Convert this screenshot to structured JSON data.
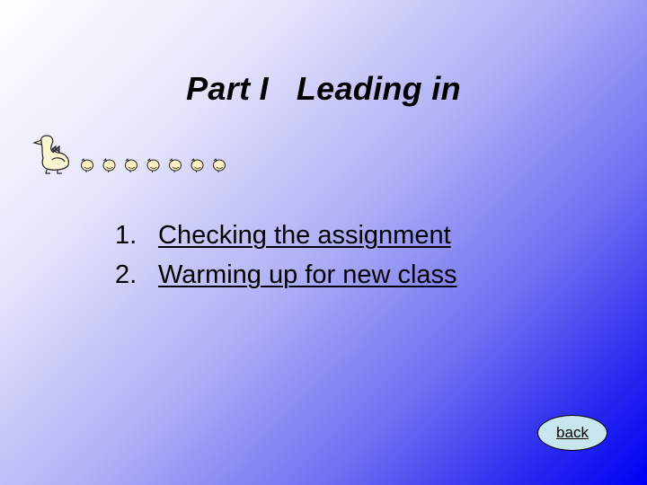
{
  "slide": {
    "title": "Part I   Leading in",
    "decoration": {
      "icon": "duck-with-ducklings-icon",
      "ducklings": 7
    },
    "items": [
      {
        "number": "1.",
        "label": "Checking the assignment"
      },
      {
        "number": "2.",
        "label": "Warming up for new class"
      }
    ],
    "back_label": "back"
  },
  "colors": {
    "gradient_start": "#ffffff",
    "gradient_end": "#0000f6",
    "back_button_fill": "#c8e6ee",
    "text": "#000000"
  }
}
